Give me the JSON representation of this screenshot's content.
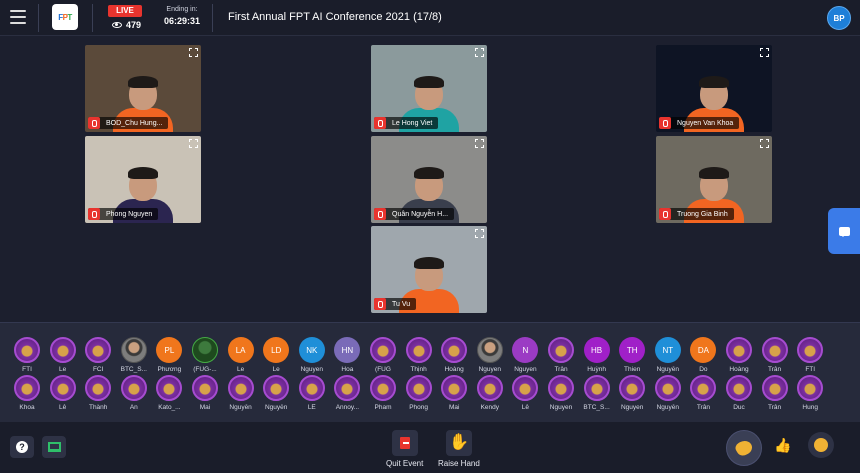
{
  "header": {
    "live_label": "LIVE",
    "viewer_count": "479",
    "ending_label": "Ending in:",
    "ending_time": "06:29:31",
    "event_title": "First Annual FPT AI Conference 2021 (17/8)",
    "user_initials": "BP",
    "logo_text": "FPT"
  },
  "tiles": [
    {
      "name": "BOD_Chu Hung...",
      "bg": "#5b4a3a",
      "shirt": "#f26522"
    },
    {
      "name": "Le Hong Viet",
      "bg": "#8b9a9c",
      "shirt": "#1fa3a3"
    },
    {
      "name": "Nguyen Van Khoa",
      "bg": "#0e1424",
      "shirt": "#f26522"
    },
    {
      "name": "Phong Nguyen",
      "bg": "#c9c2b6",
      "shirt": "#2b2550"
    },
    {
      "name": "Quân Nguyễn H...",
      "bg": "#8c8c8a",
      "shirt": "#3a3f4d"
    },
    {
      "name": "Truong Gia Binh",
      "bg": "#6e6a60",
      "shirt": "#f26522"
    },
    {
      "name": "Tu Vu",
      "bg": "#9fa7ad",
      "shirt": "#f26522"
    }
  ],
  "participants_row1": [
    {
      "name": "FTI",
      "type": "clap"
    },
    {
      "name": "Le",
      "type": "clap"
    },
    {
      "name": "FCI",
      "type": "clap"
    },
    {
      "name": "BTC_S...",
      "type": "photo"
    },
    {
      "name": "Phương",
      "type": "initials",
      "initials": "PL",
      "color": "#f0761c"
    },
    {
      "name": "(FUG-...",
      "type": "photo2"
    },
    {
      "name": "Le",
      "type": "initials",
      "initials": "LA",
      "color": "#f0761c"
    },
    {
      "name": "Le",
      "type": "initials",
      "initials": "LD",
      "color": "#f0761c"
    },
    {
      "name": "Nguyen",
      "type": "initials",
      "initials": "NK",
      "color": "#1f8fd8"
    },
    {
      "name": "Hoa",
      "type": "initials",
      "initials": "HN",
      "color": "#7a6bb8"
    },
    {
      "name": "(FUG",
      "type": "clap"
    },
    {
      "name": "Thịnh",
      "type": "clap"
    },
    {
      "name": "Hoàng",
      "type": "clap"
    },
    {
      "name": "Nguyen",
      "type": "photo"
    },
    {
      "name": "Nguyen",
      "type": "initials",
      "initials": "N",
      "color": "#9b3bc4"
    },
    {
      "name": "Trân",
      "type": "clap"
    },
    {
      "name": "Huỳnh",
      "type": "initials",
      "initials": "HB",
      "color": "#a020c8"
    },
    {
      "name": "Thien",
      "type": "initials",
      "initials": "TH",
      "color": "#a020c8"
    },
    {
      "name": "Nguyễn",
      "type": "initials",
      "initials": "NT",
      "color": "#1f8fd8"
    },
    {
      "name": "Do",
      "type": "initials",
      "initials": "DA",
      "color": "#f0761c"
    },
    {
      "name": "Hoàng",
      "type": "clap"
    },
    {
      "name": "Trân",
      "type": "clap"
    },
    {
      "name": "FTI",
      "type": "clap"
    }
  ],
  "participants_row2": [
    {
      "name": "Khoa",
      "type": "clap"
    },
    {
      "name": "Lê",
      "type": "clap"
    },
    {
      "name": "Thành",
      "type": "clap"
    },
    {
      "name": "An",
      "type": "clap"
    },
    {
      "name": "Kato_...",
      "type": "clap"
    },
    {
      "name": "Mai",
      "type": "clap"
    },
    {
      "name": "Nguyễn",
      "type": "clap"
    },
    {
      "name": "Nguyễn",
      "type": "clap"
    },
    {
      "name": "LÊ",
      "type": "clap"
    },
    {
      "name": "Annoy...",
      "type": "clap"
    },
    {
      "name": "Pham",
      "type": "clap"
    },
    {
      "name": "Phong",
      "type": "clap"
    },
    {
      "name": "Mai",
      "type": "clap"
    },
    {
      "name": "Kendy",
      "type": "clap"
    },
    {
      "name": "Lê",
      "type": "clap"
    },
    {
      "name": "Nguyen",
      "type": "clap"
    },
    {
      "name": "BTC_S...",
      "type": "clap"
    },
    {
      "name": "Nguyen",
      "type": "clap"
    },
    {
      "name": "Nguyễn",
      "type": "clap"
    },
    {
      "name": "Trân",
      "type": "clap"
    },
    {
      "name": "Duc",
      "type": "clap"
    },
    {
      "name": "Trân",
      "type": "clap"
    },
    {
      "name": "Hung",
      "type": "clap"
    }
  ],
  "footer": {
    "quit_label": "Quit Event",
    "raise_hand_label": "Raise Hand"
  }
}
